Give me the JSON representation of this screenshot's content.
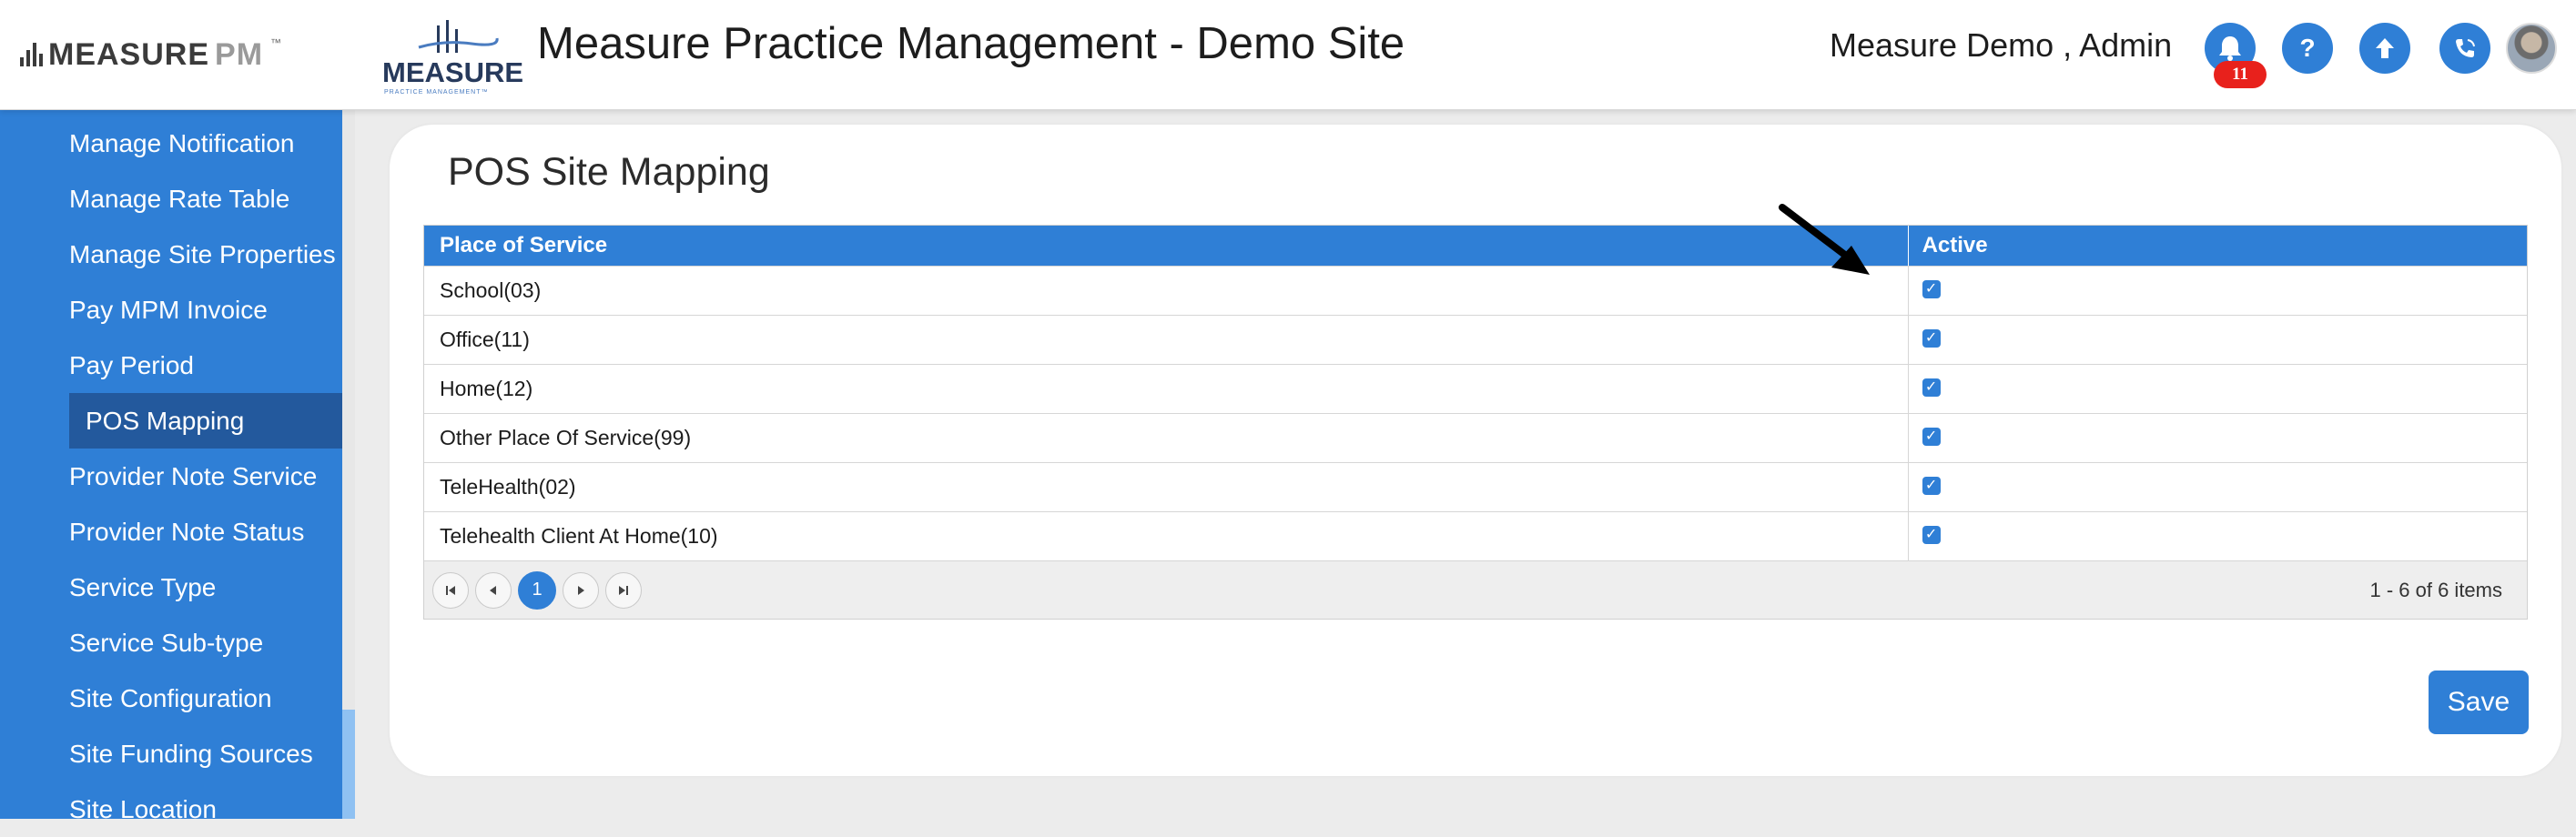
{
  "header": {
    "brand": {
      "part1": "MEASURE",
      "part2": "PM",
      "tm": "™"
    },
    "site_logo": {
      "word": "MEASURE",
      "sub": "PRACTICE MANAGEMENT™"
    },
    "title": "Measure Practice Management - Demo Site",
    "user": "Measure Demo , Admin",
    "notification_count": "11",
    "icons": [
      "bell-icon",
      "question-icon",
      "arrow-up-icon",
      "phone-icon",
      "avatar"
    ]
  },
  "sidebar": {
    "items": [
      {
        "label": "Manage Notification"
      },
      {
        "label": "Manage Rate Table"
      },
      {
        "label": "Manage Site Properties"
      },
      {
        "label": "Pay MPM Invoice"
      },
      {
        "label": "Pay Period"
      },
      {
        "label": "POS Mapping",
        "active": true
      },
      {
        "label": "Provider Note Service"
      },
      {
        "label": "Provider Note Status"
      },
      {
        "label": "Service Type"
      },
      {
        "label": "Service Sub-type"
      },
      {
        "label": "Site Configuration"
      },
      {
        "label": "Site Funding Sources"
      },
      {
        "label": "Site Location"
      }
    ]
  },
  "main": {
    "title": "POS Site Mapping",
    "table": {
      "columns": [
        "Place of Service",
        "Active"
      ],
      "rows": [
        {
          "place": "School(03)",
          "active": true
        },
        {
          "place": "Office(11)",
          "active": true
        },
        {
          "place": "Home(12)",
          "active": true
        },
        {
          "place": "Other Place Of Service(99)",
          "active": true
        },
        {
          "place": "TeleHealth(02)",
          "active": true
        },
        {
          "place": "Telehealth Client At Home(10)",
          "active": true
        }
      ]
    },
    "pager": {
      "current_page": "1",
      "info": "1 - 6 of 6 items"
    },
    "save_label": "Save"
  },
  "colors": {
    "primary": "#2f7fd6",
    "sidebar_active": "#23599d",
    "badge": "#e8211c"
  }
}
